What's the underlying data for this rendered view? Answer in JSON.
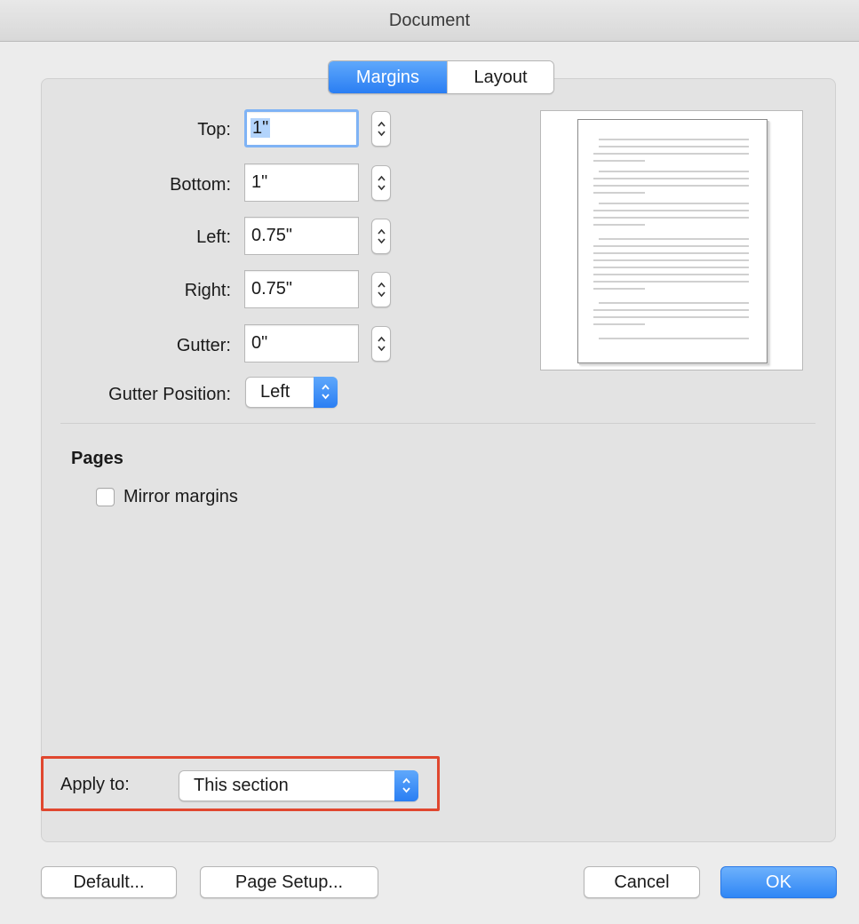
{
  "window": {
    "title": "Document"
  },
  "tabs": [
    {
      "label": "Margins",
      "active": true
    },
    {
      "label": "Layout",
      "active": false
    }
  ],
  "margins": {
    "top": {
      "label": "Top:",
      "value": "1\""
    },
    "bottom": {
      "label": "Bottom:",
      "value": "1\""
    },
    "left": {
      "label": "Left:",
      "value": "0.75\""
    },
    "right": {
      "label": "Right:",
      "value": "0.75\""
    },
    "gutter": {
      "label": "Gutter:",
      "value": "0\""
    },
    "gutter_position": {
      "label": "Gutter Position:",
      "value": "Left"
    }
  },
  "pages": {
    "heading": "Pages",
    "mirror_margins": {
      "label": "Mirror margins",
      "checked": false
    }
  },
  "apply_to": {
    "label": "Apply to:",
    "value": "This section"
  },
  "buttons": {
    "default": "Default...",
    "page_setup": "Page Setup...",
    "cancel": "Cancel",
    "ok": "OK"
  },
  "colors": {
    "accent": "#2a7ef3",
    "highlight_box": "#e0472f"
  }
}
